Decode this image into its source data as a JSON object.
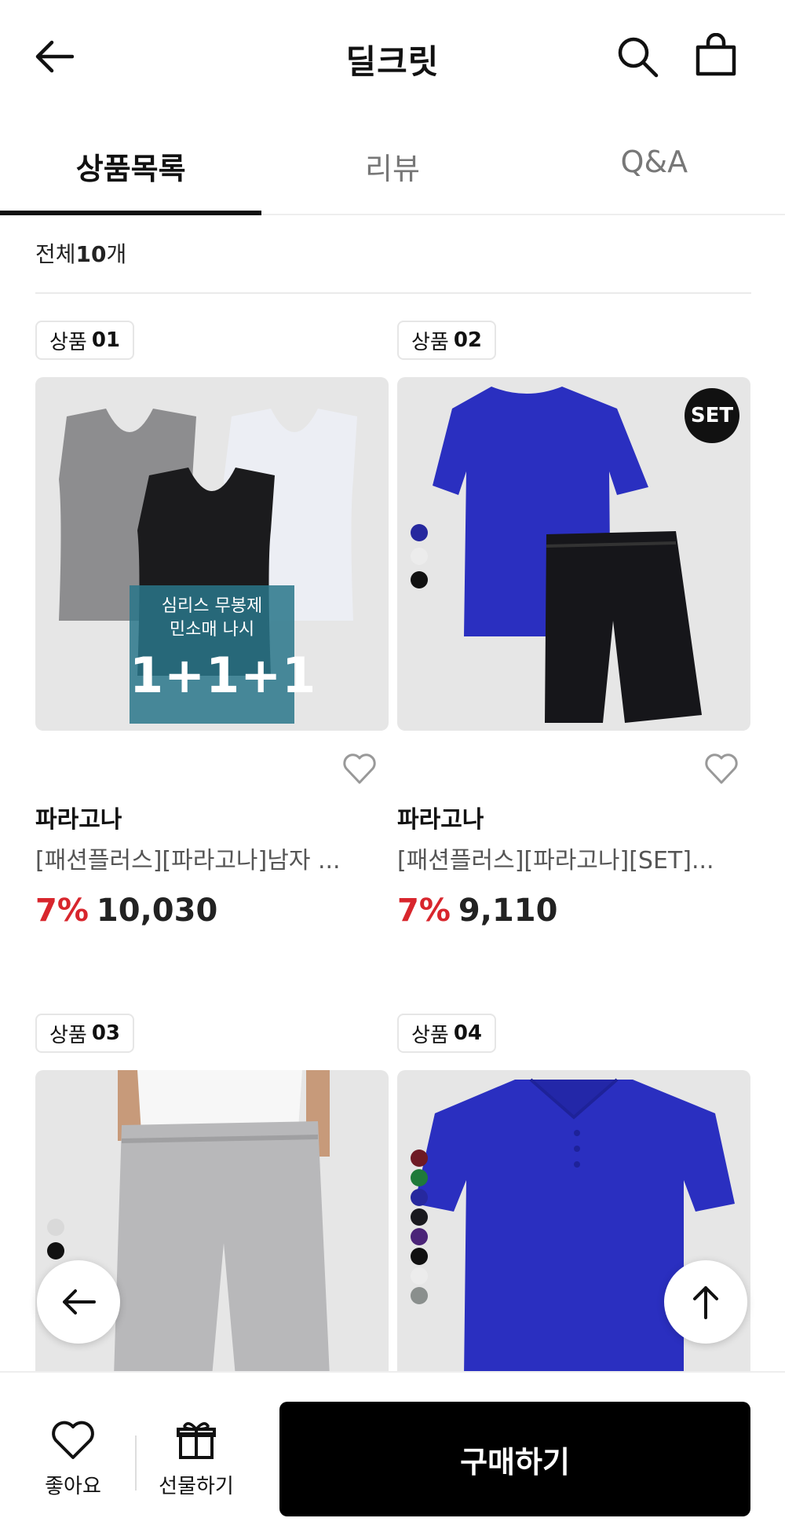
{
  "header": {
    "title": "딜크릿"
  },
  "tabs": [
    {
      "label": "상품목록",
      "active": true
    },
    {
      "label": "리뷰",
      "active": false
    },
    {
      "label": "Q&A",
      "active": false
    }
  ],
  "count": {
    "prefix": "전체",
    "number": "10",
    "suffix": "개"
  },
  "products": [
    {
      "badge_label": "상품",
      "badge_num": "01",
      "brand": "파라고나",
      "name": "[패션플러스][파라고나]남자 ...",
      "discount": "7%",
      "price": "10,030",
      "promo_line1": "심리스 무봉제",
      "promo_line2": "민소매 나시",
      "promo_big": "1+1+1"
    },
    {
      "badge_label": "상품",
      "badge_num": "02",
      "brand": "파라고나",
      "name": "[패션플러스][파라고나][SET]...",
      "discount": "7%",
      "price": "9,110",
      "set_label": "SET"
    },
    {
      "badge_label": "상품",
      "badge_num": "03"
    },
    {
      "badge_label": "상품",
      "badge_num": "04"
    }
  ],
  "colors": {
    "discount": "#d8262d",
    "buy_button": "#000000",
    "promo_bg": "#29768a",
    "shirt_blue": "#2a2fc0"
  },
  "bottom_bar": {
    "like_label": "좋아요",
    "gift_label": "선물하기",
    "buy_label": "구매하기"
  },
  "icons": [
    "back-arrow-icon",
    "search-icon",
    "shopping-bag-icon",
    "heart-icon",
    "gift-icon",
    "arrow-left-icon",
    "arrow-up-icon"
  ]
}
